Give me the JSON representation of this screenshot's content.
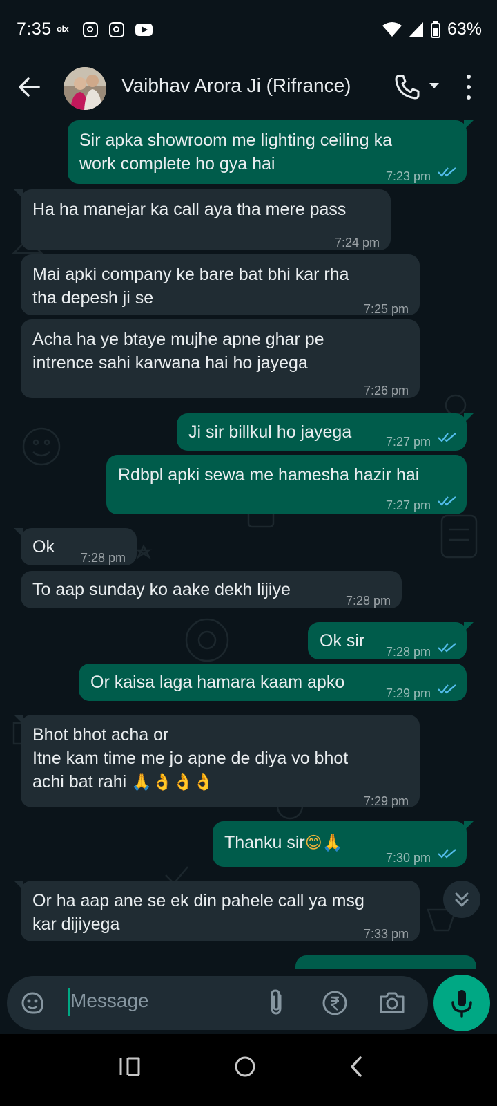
{
  "status_bar": {
    "time": "7:35",
    "notif_olx": "olx",
    "battery_text": "63%"
  },
  "header": {
    "contact_name": "Vaibhav Arora Ji (Rifrance)"
  },
  "messages": [
    {
      "direction": "out",
      "lines": [
        "Sir apka showroom me lighting ceiling ka",
        "work complete ho gya hai"
      ],
      "time": "7:23 pm",
      "status": "read"
    },
    {
      "direction": "in",
      "lines": [
        "Ha ha manejar ka call aya tha mere pass"
      ],
      "time": "7:24 pm"
    },
    {
      "direction": "in",
      "lines": [
        "Mai apki company ke bare bat bhi kar rha",
        "tha depesh ji se"
      ],
      "time": "7:25 pm"
    },
    {
      "direction": "in",
      "lines": [
        "Acha ha ye btaye mujhe apne ghar pe",
        "intrence sahi karwana hai ho jayega"
      ],
      "time": "7:26 pm"
    },
    {
      "direction": "out",
      "lines": [
        "Ji sir billkul ho jayega"
      ],
      "time": "7:27 pm",
      "status": "read"
    },
    {
      "direction": "out",
      "lines": [
        "Rdbpl apki sewa me hamesha hazir hai"
      ],
      "time": "7:27 pm",
      "status": "read"
    },
    {
      "direction": "in",
      "lines": [
        "Ok"
      ],
      "time": "7:28 pm"
    },
    {
      "direction": "in",
      "lines": [
        "To aap sunday ko aake dekh lijiye"
      ],
      "time": "7:28 pm"
    },
    {
      "direction": "out",
      "lines": [
        "Ok sir"
      ],
      "time": "7:28 pm",
      "status": "read"
    },
    {
      "direction": "out",
      "lines": [
        "Or kaisa laga hamara kaam apko"
      ],
      "time": "7:29 pm",
      "status": "read"
    },
    {
      "direction": "in",
      "lines": [
        "Bhot bhot acha or",
        "Itne kam time me jo apne de diya vo bhot",
        "achi bat rahi"
      ],
      "emoji": [
        "folded-hands",
        "ok-hand",
        "ok-hand",
        "ok-hand"
      ],
      "time": "7:29 pm"
    },
    {
      "direction": "out",
      "lines": [
        "Thanku sir"
      ],
      "emoji": [
        "smiling-face",
        "folded-hands"
      ],
      "time": "7:30 pm",
      "status": "read"
    },
    {
      "direction": "in",
      "lines": [
        "Or ha aap ane se ek din pahele call ya msg",
        "kar dijiyega"
      ],
      "time": "7:33 pm"
    }
  ],
  "composer": {
    "placeholder": "Message"
  },
  "icons": {
    "back": "arrow-left-icon",
    "call": "phone-icon",
    "more": "more-vertical-icon",
    "sticker": "sticker-icon",
    "attach": "paperclip-icon",
    "payment": "rupee-icon",
    "camera": "camera-icon",
    "mic": "mic-icon",
    "scroll_down": "double-chevron-down-icon"
  },
  "colors": {
    "background": "#0b141a",
    "incoming_bubble": "#202c33",
    "outgoing_bubble": "#005c4b",
    "accent": "#00a884",
    "read_ticks": "#53bdeb"
  }
}
